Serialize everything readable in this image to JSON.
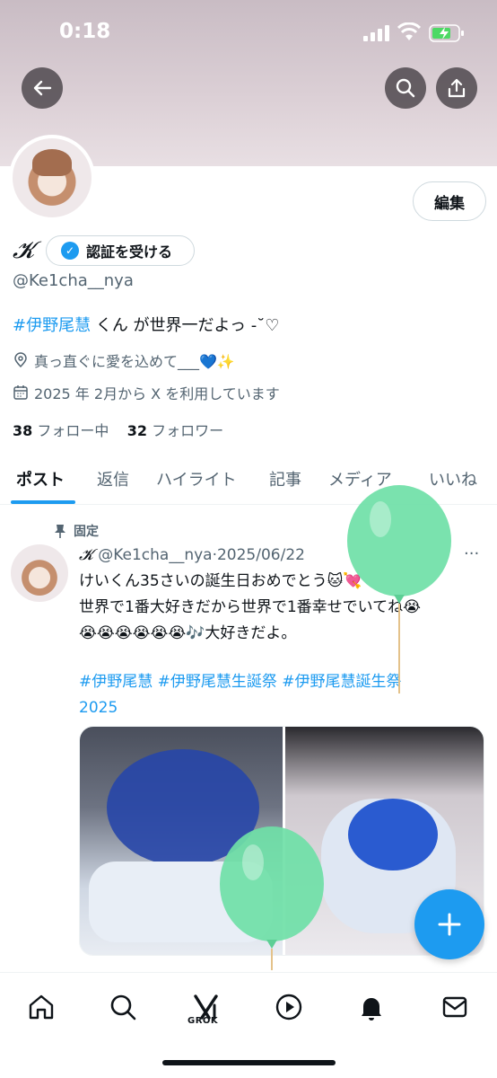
{
  "status_bar": {
    "time": "0:18"
  },
  "profile": {
    "name": "𝓚",
    "verify_label": "認証を受ける",
    "edit_label": "編集",
    "handle": "@Ke1cha__nya",
    "bio_hashtag": "#伊野尾慧",
    "bio_rest": " くん が世界一だよっ -˘♡",
    "location": "真っ直ぐに愛を込めて___💙✨",
    "joined": "2025 年 2月から X を利用しています",
    "following_count": "38",
    "following_label": "フォロー中",
    "followers_count": "32",
    "followers_label": "フォロワー"
  },
  "tabs": [
    "ポスト",
    "返信",
    "ハイライト",
    "記事",
    "メディア",
    "いいね"
  ],
  "post": {
    "pinned_label": "固定",
    "author_name": "𝓚",
    "author_handle": "@Ke1cha__nya",
    "date": "2025/06/22",
    "more": "···",
    "line1": "けいくん35さいの誕生日おめでとう🐱💘",
    "line2": "世界で1番大好きだから世界で1番幸せでいてね😭",
    "line3": "😭😭😭😭😭😭🎶大好きだよ。",
    "hashtags_line1": "#伊野尾慧 #伊野尾慧生誕祭 #伊野尾慧誕生祭",
    "hashtags_line2": "2025"
  },
  "nav": {
    "grok_label": "GROK"
  },
  "colors": {
    "accent": "#1d9bf0",
    "balloon": "#6fe0a7"
  },
  "icons": [
    "back-arrow-icon",
    "search-icon",
    "share-icon",
    "verified-badge-icon",
    "location-pin-icon",
    "calendar-icon",
    "pin-icon",
    "home-icon",
    "grok-icon",
    "video-play-icon",
    "bell-icon",
    "mail-icon",
    "plus-icon"
  ]
}
